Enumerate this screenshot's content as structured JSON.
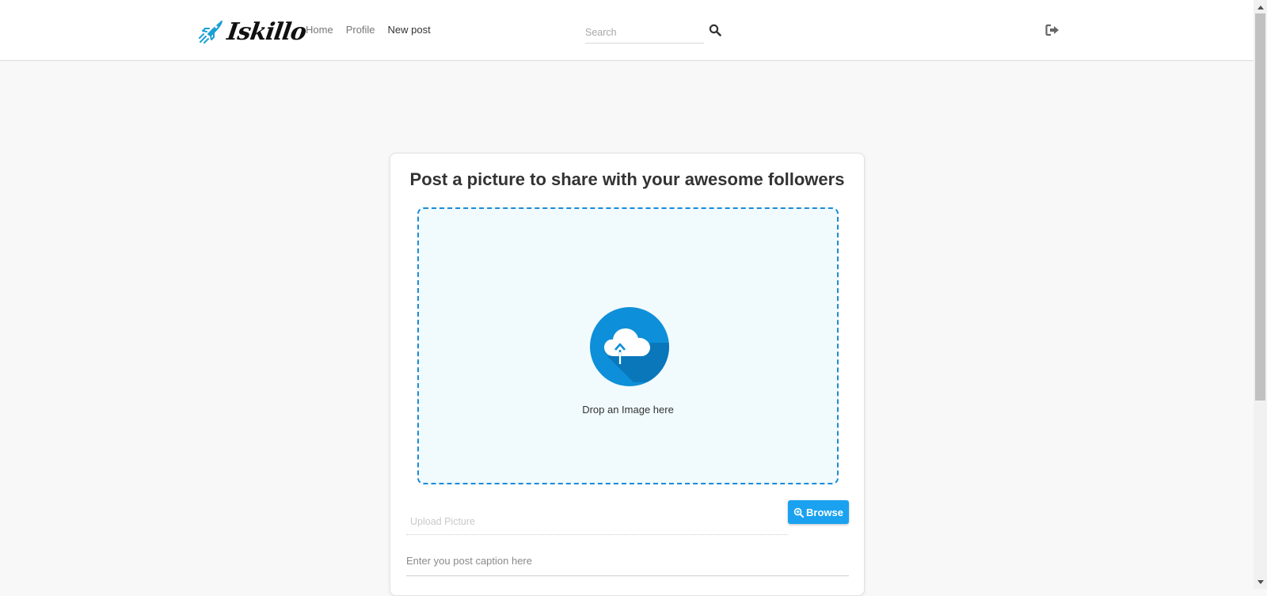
{
  "header": {
    "brand": "Iskillo",
    "nav": [
      {
        "label": "Home",
        "active": false
      },
      {
        "label": "Profile",
        "active": false
      },
      {
        "label": "New post",
        "active": true
      }
    ],
    "search": {
      "placeholder": "Search",
      "value": ""
    },
    "icons": {
      "search": "search-icon",
      "logout": "sign-out-icon",
      "brand": "rocket-icon"
    }
  },
  "card": {
    "title": "Post a picture to share with your awesome followers",
    "dropzone": {
      "text": "Drop an Image here",
      "icon": "cloud-upload-icon"
    },
    "upload": {
      "placeholder": "Upload Picture",
      "value": ""
    },
    "browse_label": "Browse",
    "browse_icon": "zoom-in-icon",
    "caption": {
      "placeholder": "Enter you post caption here",
      "value": ""
    }
  },
  "colors": {
    "accent": "#1aa2f0",
    "dropzone_border": "#1a8bd9",
    "dropzone_bg": "#f1fafd"
  }
}
